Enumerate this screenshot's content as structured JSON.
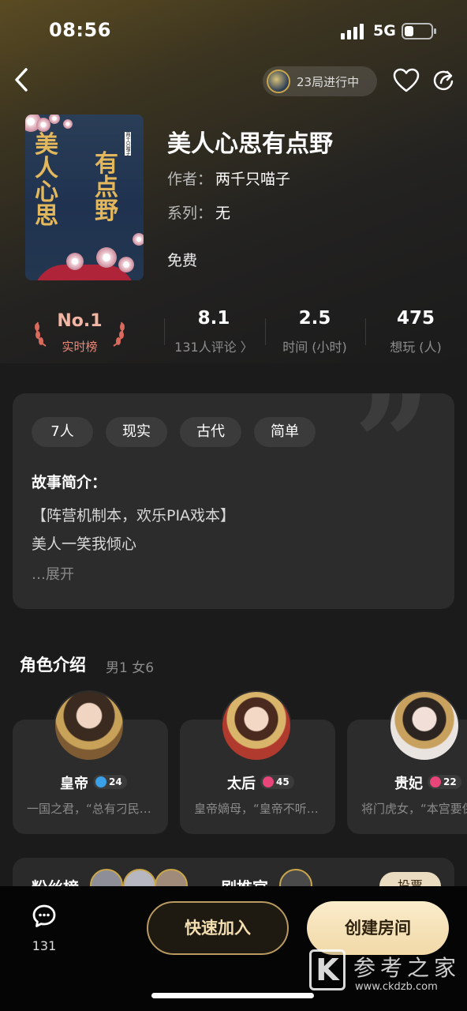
{
  "status_bar": {
    "time": "08:56",
    "network": "5G",
    "battery_level": 0.35
  },
  "header": {
    "live_text": "23局进行中"
  },
  "book": {
    "title": "美人心思有点野",
    "cover_title": "美人心思有点野",
    "cover_author": "两千只喵子",
    "author_label": "作者：",
    "author": "两千只喵子",
    "series_label": "系列：",
    "series": "无",
    "price": "免费"
  },
  "stats": {
    "rank_no": "No.1",
    "rank_label": "实时榜",
    "rating": "8.1",
    "reviews_label": "131人评论 〉",
    "duration": "2.5",
    "duration_label": "时间 (小时)",
    "want": "475",
    "want_label": "想玩 (人)"
  },
  "summary": {
    "tags": [
      "7人",
      "现实",
      "古代",
      "简单"
    ],
    "title": "故事简介：",
    "lines": [
      "【阵营机制本，欢乐PIA戏本】",
      "美人一笑我倾心"
    ],
    "expand": "…展开"
  },
  "roles": {
    "title": "角色介绍",
    "subtitle": "男1 女6",
    "items": [
      {
        "name": "皇帝",
        "badge": "24",
        "badge_color": "#3aa0e8",
        "desc": "一国之君，“总有刁民…"
      },
      {
        "name": "太后",
        "badge": "45",
        "badge_color": "#e8457a",
        "desc": "皇帝嫡母，“皇帝不听…"
      },
      {
        "name": "贵妃",
        "badge": "22",
        "badge_color": "#e8457a",
        "desc": "将门虎女，“本宫要保"
      }
    ]
  },
  "peek": {
    "fans_label": "粉丝榜",
    "recommend_label": "剧推官",
    "vote_label": "投票"
  },
  "bottom_bar": {
    "chat_count": "131",
    "join_label": "快速加入",
    "create_label": "创建房间"
  },
  "watermark": {
    "logo": "K",
    "text": "参考之家",
    "url": "www.ckdzb.com"
  },
  "colors": {
    "gold": "#f2deb0",
    "rank": "#f2b4a3",
    "card": "#2c2c2c"
  }
}
